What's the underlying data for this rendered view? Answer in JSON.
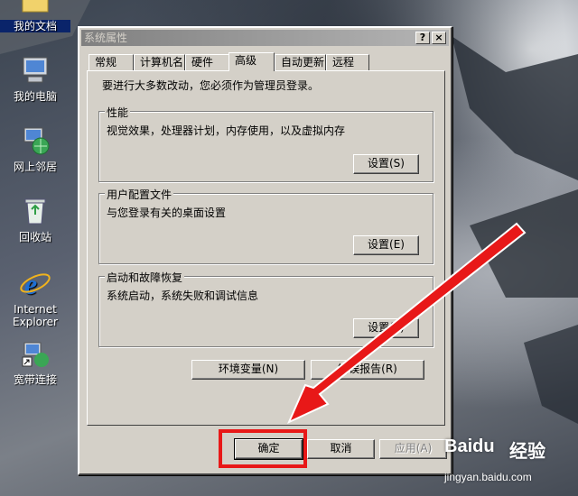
{
  "desktop": {
    "icons": [
      {
        "label": "我的文档"
      },
      {
        "label": "我的电脑"
      },
      {
        "label": "网上邻居"
      },
      {
        "label": "回收站"
      },
      {
        "label": "Internet Explorer"
      },
      {
        "label": "宽带连接"
      }
    ]
  },
  "window": {
    "title": "系统属性",
    "help_button": "?",
    "close_button": "×",
    "tabs": [
      {
        "label": "常规"
      },
      {
        "label": "计算机名"
      },
      {
        "label": "硬件"
      },
      {
        "label": "高级"
      },
      {
        "label": "自动更新"
      },
      {
        "label": "远程"
      }
    ],
    "active_tab": "高级",
    "note": "要进行大多数改动，您必须作为管理员登录。",
    "groups": [
      {
        "title": "性能",
        "desc": "视觉效果，处理器计划，内存使用，以及虚拟内存",
        "button": "设置(S)"
      },
      {
        "title": "用户配置文件",
        "desc": "与您登录有关的桌面设置",
        "button": "设置(E)"
      },
      {
        "title": "启动和故障恢复",
        "desc": "系统启动，系统失败和调试信息",
        "button": "设置(T)"
      }
    ],
    "env_button": "环境变量(N)",
    "error_button": "错误报告(R)",
    "ok_button": "确定",
    "cancel_button": "取消",
    "apply_button": "应用(A)"
  },
  "watermark": {
    "logo": "Baidu",
    "cn": "经验",
    "url": "jingyan.baidu.com"
  },
  "colors": {
    "dialog": "#d4d0c8",
    "highlight": "#e81818",
    "arrow": "#e81818"
  }
}
